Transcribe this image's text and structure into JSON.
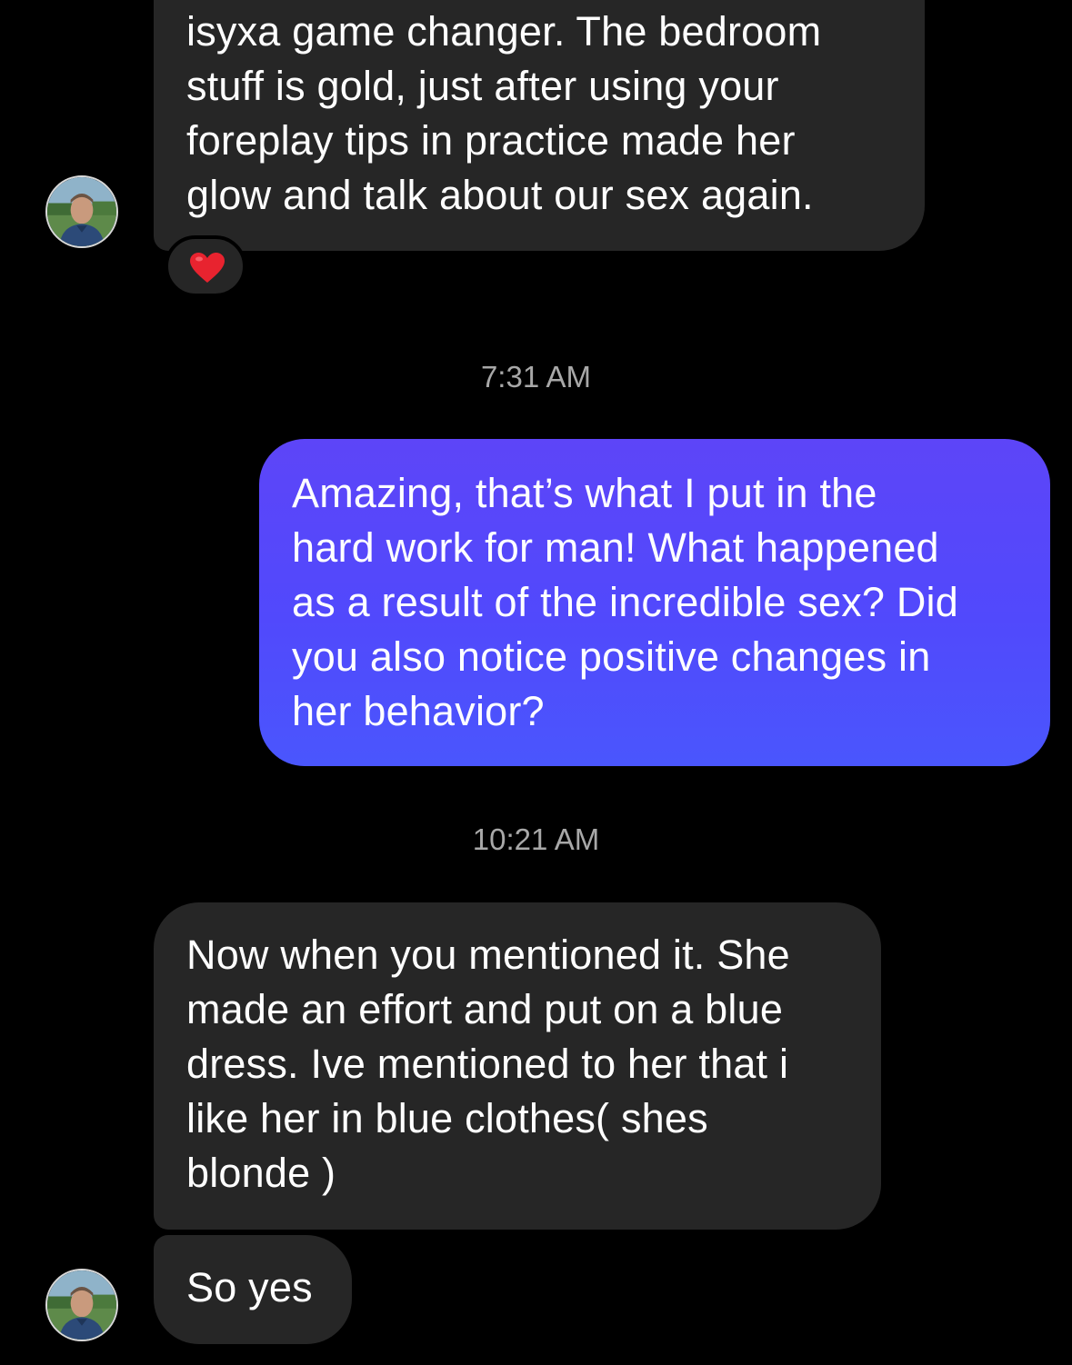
{
  "thread": {
    "messages": [
      {
        "direction": "incoming",
        "text": "isyxa game changer. The bedroom\nstuff is gold, just after using your\nforeplay tips in practice made her\nglow and talk about our sex again.",
        "reaction": "red-heart"
      },
      {
        "direction": "outgoing",
        "text": "Amazing, that’s what I put in the\nhard work for man! What happened\nas a result of the incredible sex? Did\nyou also notice positive changes in\nher behavior?"
      },
      {
        "direction": "incoming",
        "text": "Now when you mentioned it. She\nmade an effort and put on a blue\ndress. Ive mentioned to her that i\nlike her in blue clothes( shes\nblonde )"
      },
      {
        "direction": "incoming",
        "text": "So yes"
      }
    ],
    "timestamps": [
      "7:31 AM",
      "10:21 AM"
    ]
  },
  "colors": {
    "background": "#000000",
    "incoming_bubble": "#262626",
    "outgoing_bubble_top": "#5d45f8",
    "outgoing_bubble_bottom": "#4a56fd",
    "timestamp_text": "#a8a8a8",
    "reaction_heart": "#e8232f"
  },
  "icons": {
    "avatar": "contact-avatar-photo",
    "reaction": "red-heart-icon"
  }
}
